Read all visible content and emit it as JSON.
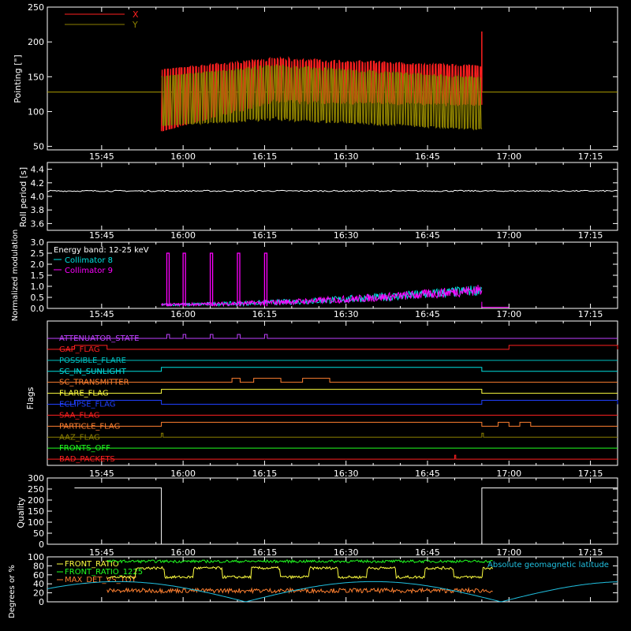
{
  "time_ticks": [
    "15:45",
    "16:00",
    "16:15",
    "16:30",
    "16:45",
    "17:00",
    "17:15"
  ],
  "chart_data": [
    {
      "type": "line",
      "ylabel": "Pointing [\"]",
      "ylim": [
        45,
        250
      ],
      "yticks": [
        "50",
        "100",
        "150",
        "200",
        "250"
      ],
      "legend": {
        "placement": "top-left"
      },
      "series": [
        {
          "name": "X",
          "color": "#ff2020",
          "band": {
            "t_start": "15:56",
            "t_end": "16:55",
            "low_start": 72,
            "low_mid": 115,
            "low_end": 110,
            "high_start": 160,
            "high_mid": 175,
            "high_end": 165
          }
        },
        {
          "name": "Y",
          "color": "#8c8000",
          "band": {
            "t_start": "15:56",
            "t_end": "16:55",
            "low_start": 80,
            "low_mid": 90,
            "low_end": 75,
            "high_start": 150,
            "high_mid": 165,
            "high_end": 148
          }
        }
      ],
      "reference_line": {
        "value": 128,
        "color": "#b0a000"
      },
      "spike": {
        "time": "16:55",
        "value": 215,
        "color": "#ff2020"
      }
    },
    {
      "type": "line",
      "ylabel": "Roll period [s]",
      "ylim": [
        3.5,
        4.5
      ],
      "yticks": [
        "3.6",
        "3.8",
        "4.0",
        "4.2",
        "4.4"
      ],
      "series": [
        {
          "color": "#ffffff",
          "value": 4.08
        }
      ]
    },
    {
      "type": "line",
      "ylabel": "Normalized modulation",
      "ylim": [
        0,
        3.0
      ],
      "yticks": [
        "0.0",
        "0.5",
        "1.0",
        "1.5",
        "2.0",
        "2.5",
        "3.0"
      ],
      "annotation": "Energy band: 12-25 keV",
      "series": [
        {
          "name": "Collimator 8",
          "color": "#00e0e0"
        },
        {
          "name": "Collimator 9",
          "color": "#ff00ff",
          "spike_times": [
            "15:57",
            "16:00",
            "16:05",
            "16:10",
            "16:15"
          ],
          "spike_value": 2.5
        }
      ]
    },
    {
      "type": "table",
      "ylabel": "Flags",
      "flags": [
        {
          "name": "ATTENUATOR_STATE",
          "color": "#c040ff",
          "pulses": [
            [
              "15:57",
              "15:57.5"
            ],
            [
              "16:00",
              "16:00.5"
            ],
            [
              "16:05",
              "16:05.5"
            ],
            [
              "16:10",
              "16:10.5"
            ],
            [
              "16:15",
              "16:15.5"
            ]
          ]
        },
        {
          "name": "GAP_FLAG",
          "color": "#ff2020",
          "pulses": [
            [
              "15:40",
              "15:46"
            ],
            [
              "17:00",
              "17:20"
            ]
          ]
        },
        {
          "name": "POSSIBLE_FLARE",
          "color": "#00c0c0",
          "pulses": []
        },
        {
          "name": "SC_IN_SUNLIGHT",
          "color": "#00e0e0",
          "pulses": [
            [
              "15:56",
              "16:55"
            ]
          ]
        },
        {
          "name": "SC_TRANSMITTER",
          "color": "#ff8030",
          "pulses": [
            [
              "16:09",
              "16:10.5"
            ],
            [
              "16:13",
              "16:18"
            ],
            [
              "16:22",
              "16:27"
            ]
          ]
        },
        {
          "name": "FLARE_FLAG",
          "color": "#ffff40",
          "pulses": [
            [
              "15:56",
              "16:55"
            ]
          ]
        },
        {
          "name": "ECLIPSE_FLAG",
          "color": "#2040ff",
          "pulses": [
            [
              "15:40",
              "15:56"
            ],
            [
              "16:55",
              "17:20"
            ]
          ]
        },
        {
          "name": "SAA_FLAG",
          "color": "#ff2020",
          "pulses": []
        },
        {
          "name": "PARTICLE_FLAG",
          "color": "#ff8030",
          "pulses": [
            [
              "15:56",
              "16:55"
            ],
            [
              "16:58",
              "17:00"
            ],
            [
              "17:02",
              "17:04"
            ]
          ]
        },
        {
          "name": "AAZ_FLAG",
          "color": "#8c8000",
          "pulses": [
            [
              "15:56",
              "15:56.3"
            ],
            [
              "16:55",
              "16:55.3"
            ]
          ]
        },
        {
          "name": "FRONTS_OFF",
          "color": "#20ff20",
          "pulses": []
        },
        {
          "name": "BAD_PACKETS",
          "color": "#ff2020",
          "pulses": [
            [
              "16:50",
              "16:50.2"
            ]
          ]
        }
      ]
    },
    {
      "type": "line",
      "ylabel": "Quality",
      "ylim": [
        0,
        300
      ],
      "yticks": [
        "0",
        "50",
        "100",
        "150",
        "200",
        "250",
        "300"
      ],
      "series": [
        {
          "color": "#ffffff",
          "points": [
            [
              "15:40",
              255
            ],
            [
              "15:56",
              255
            ],
            [
              "15:56",
              0
            ],
            [
              "16:55",
              0
            ],
            [
              "16:55",
              255
            ],
            [
              "17:20",
              255
            ]
          ]
        }
      ]
    },
    {
      "type": "line",
      "ylabel": "Degrees or %",
      "ylim": [
        0,
        100
      ],
      "yticks": [
        "0",
        "20",
        "40",
        "60",
        "80",
        "100"
      ],
      "series": [
        {
          "name": "FRONT_RATIO",
          "color": "#ffff40",
          "level": 55
        },
        {
          "name": "FRONT_RATIO_1225",
          "color": "#20ff20",
          "level": 90
        },
        {
          "name": "MAX_DET_VS_TOT",
          "color": "#ff8030",
          "level": 25
        },
        {
          "name": "Absolute geomagnetic latitude",
          "color": "#20c0e0",
          "amplitude": 45
        }
      ]
    }
  ]
}
